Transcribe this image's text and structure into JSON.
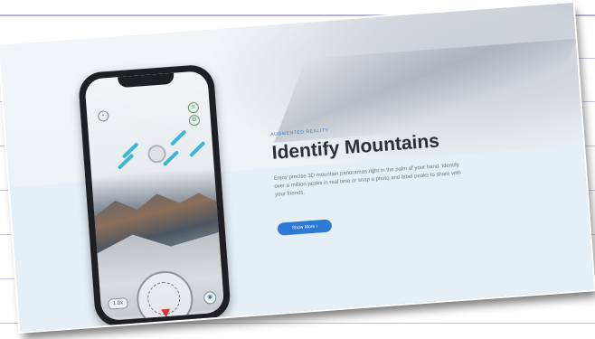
{
  "promo": {
    "eyebrow": "AUGMENTED REALITY",
    "headline": "Identify Mountains",
    "description": "Enjoy precise 3D mountain panoramas right in the palm of your hand. Identify over a million peaks in real time or snap a photo and label peaks to share with your friends.",
    "cta_label": "Show More ›",
    "accent_color": "#2e79d6"
  },
  "phone": {
    "zoom_label": "1.0x",
    "icons": [
      "home-icon",
      "layers-icon",
      "settings-icon",
      "camera-icon",
      "compass-icon"
    ]
  }
}
